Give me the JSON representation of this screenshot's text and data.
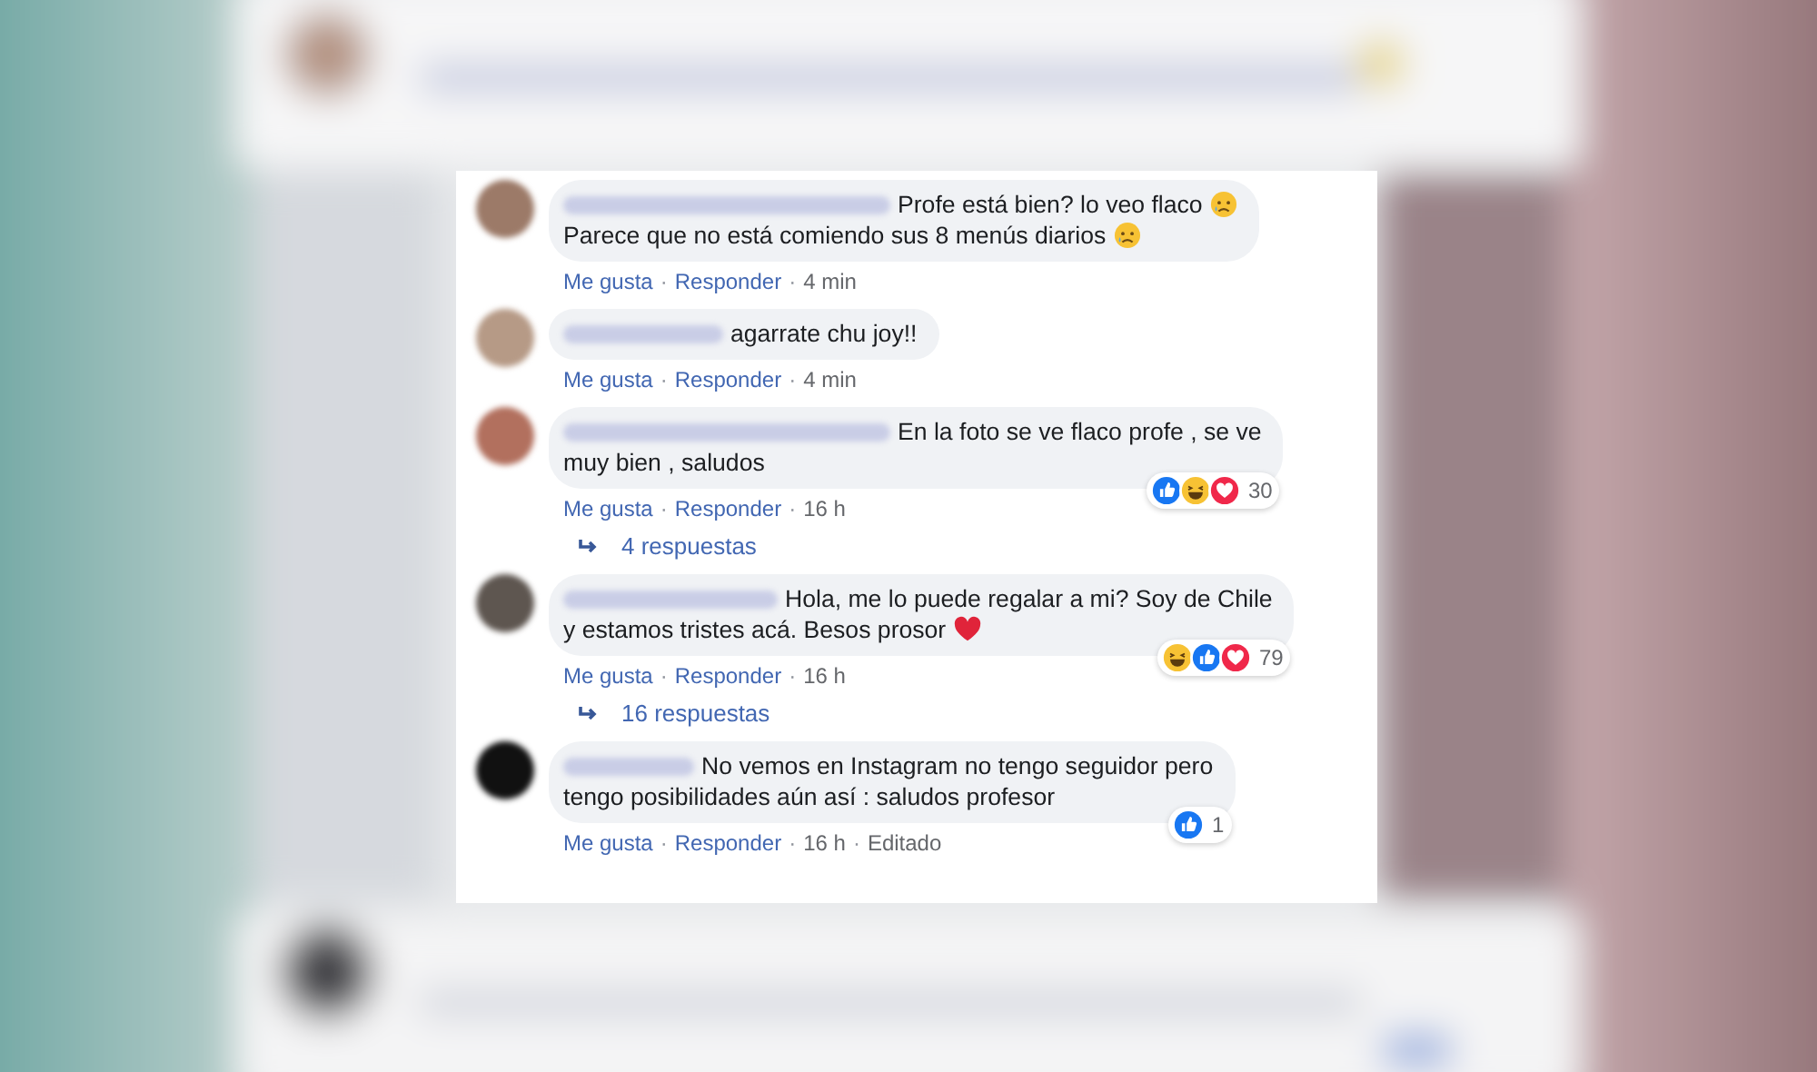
{
  "separator": "·",
  "comments": [
    {
      "lines": [
        {
          "text": "Profe está bien? lo veo flaco",
          "kind": "sad-emoji"
        },
        {
          "text": "Parece que no está comiendo sus 8 menús diarios",
          "kind": "sad-emoji"
        }
      ],
      "meta": [
        {
          "kind": "link",
          "text": "Me gusta"
        },
        {
          "kind": "link",
          "text": "Responder"
        },
        {
          "kind": "time",
          "text": "4 min"
        }
      ]
    },
    {
      "lines": [
        {
          "text": "agarrate chu joy!!",
          "kind": "plain"
        }
      ],
      "meta": [
        {
          "kind": "link",
          "text": "Me gusta"
        },
        {
          "kind": "link",
          "text": "Responder"
        },
        {
          "kind": "time",
          "text": "4 min"
        }
      ]
    },
    {
      "lines": [
        {
          "text": "En la foto se ve flaco profe , se ve",
          "kind": "plain"
        },
        {
          "text": "muy bien , saludos",
          "kind": "plain"
        }
      ],
      "meta": [
        {
          "kind": "link",
          "text": "Me gusta"
        },
        {
          "kind": "link",
          "text": "Responder"
        },
        {
          "kind": "time",
          "text": "16 h"
        }
      ],
      "reactions": [
        {
          "kind": "like"
        },
        {
          "kind": "haha"
        },
        {
          "kind": "love"
        }
      ],
      "reaction_count": "30",
      "replies": "4 respuestas"
    },
    {
      "lines": [
        {
          "text": "Hola, me lo puede regalar a mi? Soy de Chile",
          "kind": "plain"
        },
        {
          "text": "y estamos tristes acá. Besos prosor",
          "kind": "heart-emoji"
        }
      ],
      "meta": [
        {
          "kind": "link",
          "text": "Me gusta"
        },
        {
          "kind": "link",
          "text": "Responder"
        },
        {
          "kind": "time",
          "text": "16 h"
        }
      ],
      "reactions": [
        {
          "kind": "haha"
        },
        {
          "kind": "like"
        },
        {
          "kind": "love"
        }
      ],
      "reaction_count": "79",
      "replies": "16 respuestas"
    },
    {
      "lines": [
        {
          "text": "No vemos en Instagram no tengo seguidor pero",
          "kind": "plain"
        },
        {
          "text": "tengo posibilidades aún así : saludos profesor",
          "kind": "plain"
        }
      ],
      "meta": [
        {
          "kind": "link",
          "text": "Me gusta"
        },
        {
          "kind": "link",
          "text": "Responder"
        },
        {
          "kind": "time",
          "text": "16 h"
        },
        {
          "kind": "time",
          "text": "Editado"
        }
      ],
      "reactions": [
        {
          "kind": "like"
        }
      ],
      "reaction_count": "1"
    }
  ]
}
